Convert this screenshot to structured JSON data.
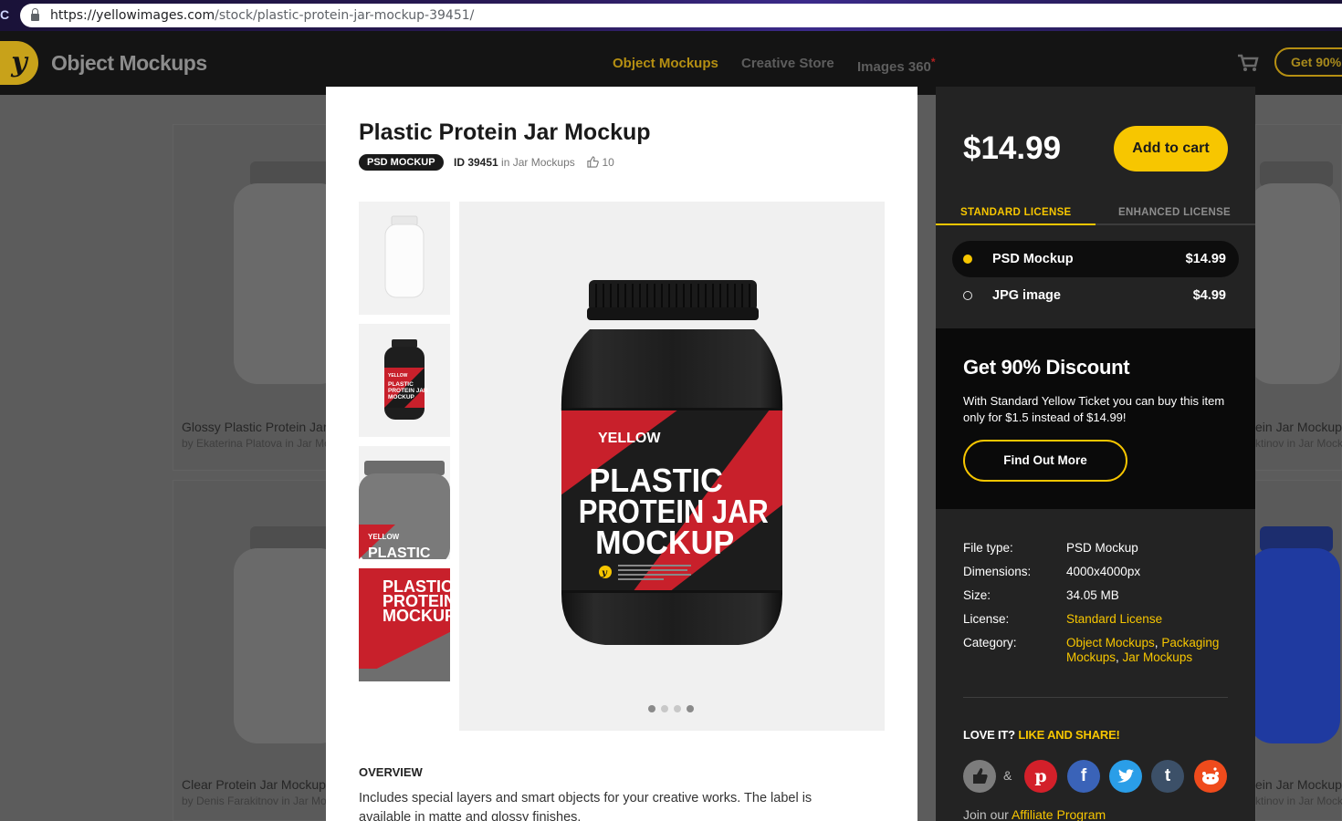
{
  "browser": {
    "url_host": "https://yellowimages.com",
    "url_path": "/stock/plastic-protein-jar-mockup-39451/",
    "left_fragment": "C"
  },
  "header": {
    "brand": "Object Mockups",
    "nav": [
      "Object Mockups",
      "Creative Store",
      "Images 360"
    ],
    "nav_mark": "*",
    "get_btn": "Get 90%"
  },
  "background_cards": [
    {
      "title": "Glossy Plastic Protein Jar",
      "by": "by Ekaterina Platova in Jar Mo"
    },
    {
      "title": "Clear Protein Jar Mockup",
      "by": "by Denis Farakitnov in Jar Mo"
    },
    {
      "title": "ein Jar Mockup",
      "by": "ktinov in Jar Mock"
    },
    {
      "title": "ein Jar Mockup",
      "by": "ktinov in Jar Mock"
    }
  ],
  "product": {
    "title": "Plastic Protein Jar Mockup",
    "badge": "PSD MOCKUP",
    "id_label": "ID 39451",
    "in_text": "in",
    "category": "Jar Mockups",
    "likes": "10",
    "overview_heading": "OVERVIEW",
    "overview_text": "Includes special layers and smart objects for your creative works. The label is available in matte and glossy finishes."
  },
  "jar_label": {
    "brand": "YELLOW",
    "line1": "PLASTIC",
    "line2": "PROTEIN JAR",
    "line3": "MOCKUP",
    "thumb_short": "PROTEIN JA"
  },
  "gallery": {
    "slides": 4,
    "active": 0
  },
  "purchase": {
    "price": "$14.99",
    "add_to_cart": "Add to cart",
    "tabs": [
      "STANDARD LICENSE",
      "ENHANCED LICENSE"
    ],
    "options": [
      {
        "name": "PSD Mockup",
        "price": "$14.99",
        "selected": true
      },
      {
        "name": "JPG image",
        "price": "$4.99",
        "selected": false
      }
    ]
  },
  "discount": {
    "heading": "Get 90% Discount",
    "text": "With Standard Yellow Ticket you can buy this item only for $1.5 instead of $14.99!",
    "button": "Find Out More"
  },
  "info": {
    "file_type_k": "File type:",
    "file_type_v": "PSD Mockup",
    "dimensions_k": "Dimensions:",
    "dimensions_v": "4000x4000px",
    "size_k": "Size:",
    "size_v": "34.05 MB",
    "license_k": "License:",
    "license_v": "Standard License",
    "category_k": "Category:",
    "category_v1": "Object Mockups",
    "category_v2": "Packaging Mockups",
    "category_v3": "Jar Mockups"
  },
  "share": {
    "love": "LOVE IT?",
    "cta": "LIKE AND SHARE!",
    "amp": "&",
    "join": "Join our",
    "affiliate": "Affiliate Program"
  },
  "colors": {
    "accent": "#f7c600",
    "panel": "#232323",
    "dark": "#0a0a0a",
    "jar_red": "#c8202b"
  }
}
